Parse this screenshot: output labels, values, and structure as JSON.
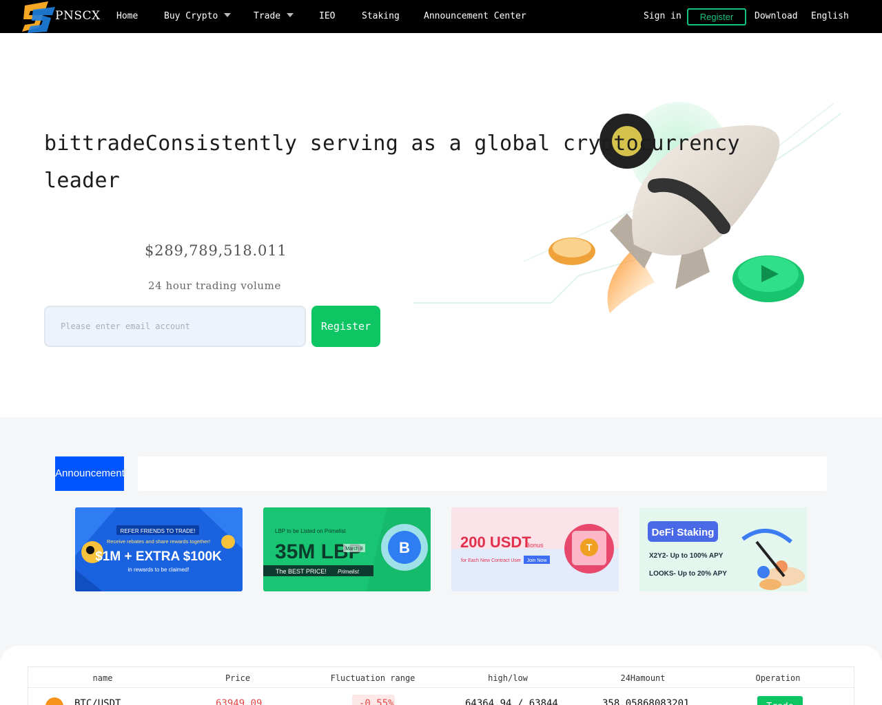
{
  "nav": {
    "brand": "PNSCX",
    "items": [
      {
        "label": "Home"
      },
      {
        "label": "Buy Crypto"
      },
      {
        "label": "Trade"
      },
      {
        "label": "IEO"
      },
      {
        "label": "Staking"
      },
      {
        "label": "Announcement Center"
      }
    ],
    "sign_in": "Sign in",
    "register": "Register",
    "download": "Download",
    "language": "English"
  },
  "hero": {
    "title": "bittradeConsistently serving as a global cryptocurrency leader",
    "volume_value": "$289,789,518.011",
    "volume_label": "24 hour trading volume",
    "email_placeholder": "Please enter email account",
    "register_button": "Register"
  },
  "announcement": {
    "tab_label": "Announcement"
  },
  "banners": [
    {
      "top": "REFER FRIENDS TO TRADE!",
      "line2": "Receive rebates and share rewards together!",
      "main": "$1M + EXTRA $100K",
      "sub": "in rewards to be claimed!"
    },
    {
      "top": "LBP to be Listed on Primelist",
      "main": "35M LBP",
      "date": "March 8",
      "sub": "The BEST PRICE!",
      "brand": "Primelist"
    },
    {
      "main": "200 USDT",
      "bonus": "Bonus",
      "sub": "for Each New Contract User",
      "cta": "Join Now"
    },
    {
      "main": "DeFi Staking",
      "line1": "X2Y2- Up to 100% APY",
      "line2": "LOOKS- Up to 20% APY"
    }
  ],
  "market": {
    "columns": [
      "name",
      "Price",
      "Fluctuation range",
      "high/low",
      "24Hamount",
      "Operation"
    ],
    "rows": [
      {
        "name": "BTC/USDT",
        "price": "63949.09",
        "change": "-0.55%",
        "high_low": "64364.94 / 63844",
        "amount": "358.05868083201",
        "action": "Trade"
      }
    ]
  },
  "colors": {
    "accent_green": "#0ec563",
    "tab_blue": "#0055ff",
    "negative_red": "#e64545"
  }
}
